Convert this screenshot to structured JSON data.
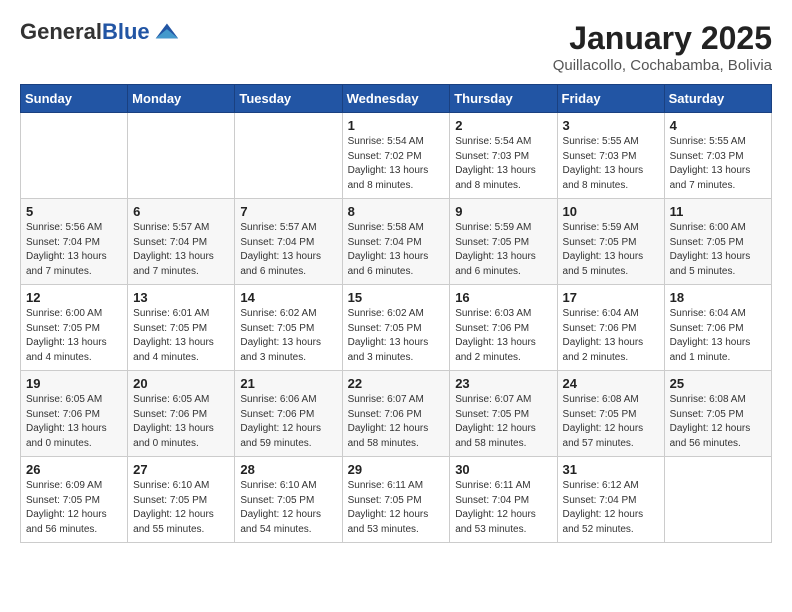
{
  "header": {
    "logo_general": "General",
    "logo_blue": "Blue",
    "month_title": "January 2025",
    "location": "Quillacollo, Cochabamba, Bolivia"
  },
  "weekdays": [
    "Sunday",
    "Monday",
    "Tuesday",
    "Wednesday",
    "Thursday",
    "Friday",
    "Saturday"
  ],
  "weeks": [
    [
      {
        "day": "",
        "info": ""
      },
      {
        "day": "",
        "info": ""
      },
      {
        "day": "",
        "info": ""
      },
      {
        "day": "1",
        "info": "Sunrise: 5:54 AM\nSunset: 7:02 PM\nDaylight: 13 hours and 8 minutes."
      },
      {
        "day": "2",
        "info": "Sunrise: 5:54 AM\nSunset: 7:03 PM\nDaylight: 13 hours and 8 minutes."
      },
      {
        "day": "3",
        "info": "Sunrise: 5:55 AM\nSunset: 7:03 PM\nDaylight: 13 hours and 8 minutes."
      },
      {
        "day": "4",
        "info": "Sunrise: 5:55 AM\nSunset: 7:03 PM\nDaylight: 13 hours and 7 minutes."
      }
    ],
    [
      {
        "day": "5",
        "info": "Sunrise: 5:56 AM\nSunset: 7:04 PM\nDaylight: 13 hours and 7 minutes."
      },
      {
        "day": "6",
        "info": "Sunrise: 5:57 AM\nSunset: 7:04 PM\nDaylight: 13 hours and 7 minutes."
      },
      {
        "day": "7",
        "info": "Sunrise: 5:57 AM\nSunset: 7:04 PM\nDaylight: 13 hours and 6 minutes."
      },
      {
        "day": "8",
        "info": "Sunrise: 5:58 AM\nSunset: 7:04 PM\nDaylight: 13 hours and 6 minutes."
      },
      {
        "day": "9",
        "info": "Sunrise: 5:59 AM\nSunset: 7:05 PM\nDaylight: 13 hours and 6 minutes."
      },
      {
        "day": "10",
        "info": "Sunrise: 5:59 AM\nSunset: 7:05 PM\nDaylight: 13 hours and 5 minutes."
      },
      {
        "day": "11",
        "info": "Sunrise: 6:00 AM\nSunset: 7:05 PM\nDaylight: 13 hours and 5 minutes."
      }
    ],
    [
      {
        "day": "12",
        "info": "Sunrise: 6:00 AM\nSunset: 7:05 PM\nDaylight: 13 hours and 4 minutes."
      },
      {
        "day": "13",
        "info": "Sunrise: 6:01 AM\nSunset: 7:05 PM\nDaylight: 13 hours and 4 minutes."
      },
      {
        "day": "14",
        "info": "Sunrise: 6:02 AM\nSunset: 7:05 PM\nDaylight: 13 hours and 3 minutes."
      },
      {
        "day": "15",
        "info": "Sunrise: 6:02 AM\nSunset: 7:05 PM\nDaylight: 13 hours and 3 minutes."
      },
      {
        "day": "16",
        "info": "Sunrise: 6:03 AM\nSunset: 7:06 PM\nDaylight: 13 hours and 2 minutes."
      },
      {
        "day": "17",
        "info": "Sunrise: 6:04 AM\nSunset: 7:06 PM\nDaylight: 13 hours and 2 minutes."
      },
      {
        "day": "18",
        "info": "Sunrise: 6:04 AM\nSunset: 7:06 PM\nDaylight: 13 hours and 1 minute."
      }
    ],
    [
      {
        "day": "19",
        "info": "Sunrise: 6:05 AM\nSunset: 7:06 PM\nDaylight: 13 hours and 0 minutes."
      },
      {
        "day": "20",
        "info": "Sunrise: 6:05 AM\nSunset: 7:06 PM\nDaylight: 13 hours and 0 minutes."
      },
      {
        "day": "21",
        "info": "Sunrise: 6:06 AM\nSunset: 7:06 PM\nDaylight: 12 hours and 59 minutes."
      },
      {
        "day": "22",
        "info": "Sunrise: 6:07 AM\nSunset: 7:06 PM\nDaylight: 12 hours and 58 minutes."
      },
      {
        "day": "23",
        "info": "Sunrise: 6:07 AM\nSunset: 7:05 PM\nDaylight: 12 hours and 58 minutes."
      },
      {
        "day": "24",
        "info": "Sunrise: 6:08 AM\nSunset: 7:05 PM\nDaylight: 12 hours and 57 minutes."
      },
      {
        "day": "25",
        "info": "Sunrise: 6:08 AM\nSunset: 7:05 PM\nDaylight: 12 hours and 56 minutes."
      }
    ],
    [
      {
        "day": "26",
        "info": "Sunrise: 6:09 AM\nSunset: 7:05 PM\nDaylight: 12 hours and 56 minutes."
      },
      {
        "day": "27",
        "info": "Sunrise: 6:10 AM\nSunset: 7:05 PM\nDaylight: 12 hours and 55 minutes."
      },
      {
        "day": "28",
        "info": "Sunrise: 6:10 AM\nSunset: 7:05 PM\nDaylight: 12 hours and 54 minutes."
      },
      {
        "day": "29",
        "info": "Sunrise: 6:11 AM\nSunset: 7:05 PM\nDaylight: 12 hours and 53 minutes."
      },
      {
        "day": "30",
        "info": "Sunrise: 6:11 AM\nSunset: 7:04 PM\nDaylight: 12 hours and 53 minutes."
      },
      {
        "day": "31",
        "info": "Sunrise: 6:12 AM\nSunset: 7:04 PM\nDaylight: 12 hours and 52 minutes."
      },
      {
        "day": "",
        "info": ""
      }
    ]
  ]
}
